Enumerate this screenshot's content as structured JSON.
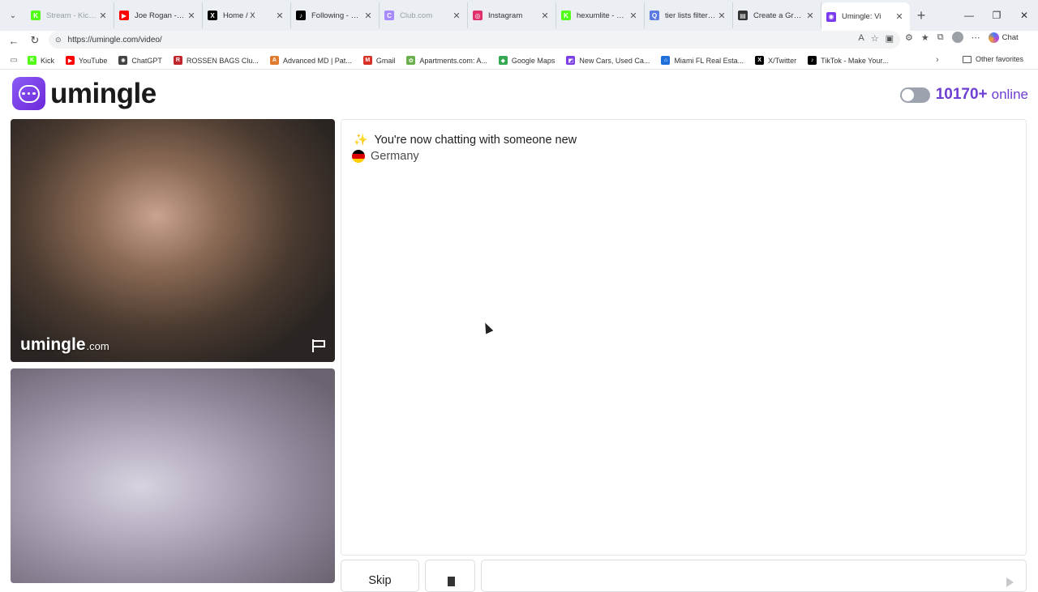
{
  "browser": {
    "tabs": [
      {
        "title": "Stream - Kick Da",
        "color": "#53fc18",
        "glyph": "K",
        "dim": true
      },
      {
        "title": "Joe Rogan - He l",
        "color": "#ff0000",
        "glyph": "▶",
        "dim": false
      },
      {
        "title": "Home / X",
        "color": "#000000",
        "glyph": "X",
        "dim": false
      },
      {
        "title": "Following - Watc",
        "color": "#000000",
        "glyph": "♪",
        "dim": false
      },
      {
        "title": "Club.com",
        "color": "#a78bfa",
        "glyph": "C",
        "dim": true
      },
      {
        "title": "Instagram",
        "color": "#e1306c",
        "glyph": "◎",
        "dim": false
      },
      {
        "title": "hexumlite - Watc",
        "color": "#53fc18",
        "glyph": "K",
        "dim": false
      },
      {
        "title": "tier lists filters - S",
        "color": "#5b7be0",
        "glyph": "Q",
        "dim": false
      },
      {
        "title": "Create a Greater",
        "color": "#333333",
        "glyph": "▤",
        "dim": false
      },
      {
        "title": "Umingle: Vi",
        "color": "#7c3aed",
        "glyph": "◉",
        "dim": false,
        "active": true
      }
    ],
    "url": "https://umingle.com/video/",
    "copilot_label": "Chat",
    "bookmarks": [
      {
        "label": "Kick",
        "color": "#53fc18",
        "glyph": "K"
      },
      {
        "label": "YouTube",
        "color": "#ff0000",
        "glyph": "▶"
      },
      {
        "label": "ChatGPT",
        "color": "#444444",
        "glyph": "✺"
      },
      {
        "label": "ROSSEN BAGS Clu...",
        "color": "#c0262d",
        "glyph": "R"
      },
      {
        "label": "Advanced MD | Pat...",
        "color": "#e07a2e",
        "glyph": "A"
      },
      {
        "label": "Gmail",
        "color": "#d93025",
        "glyph": "M"
      },
      {
        "label": "Apartments.com: A...",
        "color": "#6ab04c",
        "glyph": "✿"
      },
      {
        "label": "Google Maps",
        "color": "#34a853",
        "glyph": "◆"
      },
      {
        "label": "New Cars, Used Ca...",
        "color": "#7b3fe4",
        "glyph": "◩"
      },
      {
        "label": "Miami FL Real Esta...",
        "color": "#1e6fd9",
        "glyph": "⌂"
      },
      {
        "label": "X/Twitter",
        "color": "#000000",
        "glyph": "X"
      },
      {
        "label": "TikTok - Make Your...",
        "color": "#000000",
        "glyph": "♪"
      }
    ],
    "other_favorites": "Other favorites"
  },
  "page": {
    "logo_text": "umingle",
    "online_count": "10170+",
    "online_label": "online",
    "watermark_main": "umingle",
    "watermark_suffix": ".com",
    "chat": {
      "system_message": "You're now chatting with someone new",
      "country": "Germany"
    },
    "skip_label": "Skip",
    "message_placeholder": ""
  },
  "colors": {
    "brand": "#6d3fd2",
    "flag_black": "#000000",
    "flag_red": "#dd0000",
    "flag_gold": "#ffce00"
  }
}
